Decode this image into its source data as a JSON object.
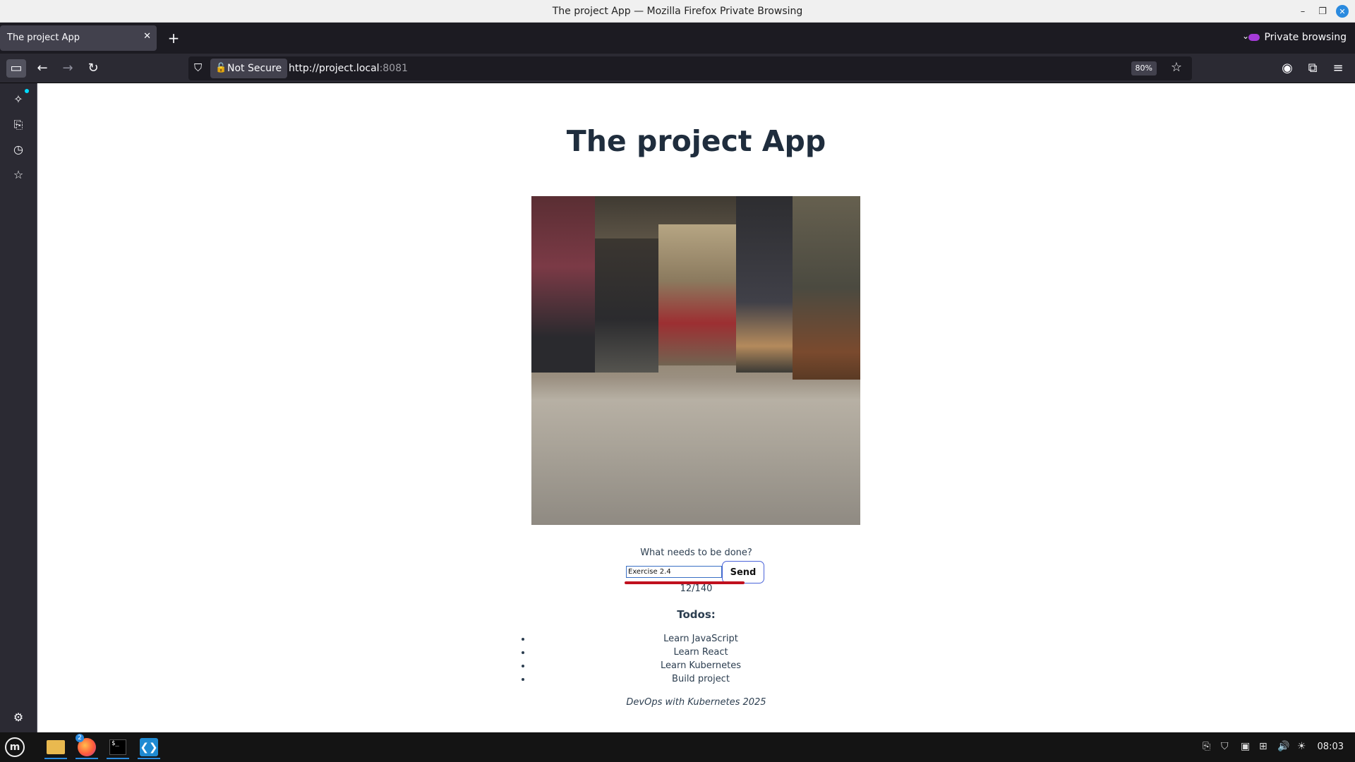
{
  "window": {
    "title": "The project App — Mozilla Firefox Private Browsing",
    "min_icon": "–",
    "max_icon": "❐",
    "close_icon": "✕"
  },
  "tabs": {
    "active_title": "The project App",
    "close_icon": "✕",
    "new_tab_icon": "+",
    "list_icon": "⌄",
    "private_label": "Private browsing"
  },
  "navbar": {
    "back_icon": "←",
    "forward_icon": "→",
    "reload_icon": "↻",
    "sidebar_icon": "▭",
    "shield_icon": "⛉",
    "not_secure_label": "Not Secure",
    "lock_icon": "🔓",
    "url_main": "http://project.local",
    "url_port": ":8081",
    "zoom": "80%",
    "bookmark_icon": "☆",
    "account_icon": "◉",
    "extensions_icon": "⧉",
    "menu_icon": "≡"
  },
  "sidebar": {
    "ai_icon": "✧",
    "synced_tabs_icon": "⎘",
    "history_icon": "◷",
    "bookmarks_icon": "☆",
    "settings_icon": "⚙"
  },
  "page": {
    "heading": "The project App",
    "prompt": "What needs to be done?",
    "input_value": "Exercise 2.4",
    "send_label": "Send",
    "counter": "12/140",
    "todos_heading": "Todos:",
    "todos": [
      "Learn JavaScript",
      "Learn React",
      "Learn Kubernetes",
      "Build project"
    ],
    "footer": "DevOps with Kubernetes 2025"
  },
  "taskbar": {
    "menu_label": "m",
    "firefox_badge": "2",
    "terminal_label": "$_",
    "vscode_label": "❮❯",
    "clock": "08:03",
    "tray_icons": [
      "⎘",
      "⛉",
      "▣",
      "⊞",
      "🔊",
      "☀"
    ]
  },
  "colors": {
    "accent": "#2a8adf",
    "underline_mark": "#c0101e",
    "toolbar_dark": "#2b2a33"
  }
}
